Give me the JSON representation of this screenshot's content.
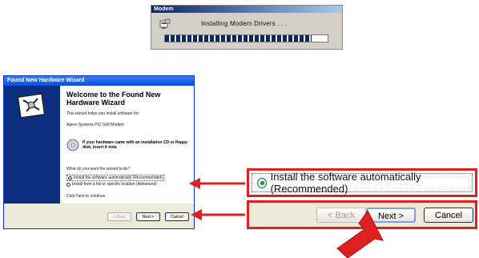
{
  "modem_dialog": {
    "title": "Modem",
    "status": "Installing Modem Drivers . . .",
    "progress": 0.9
  },
  "wizard": {
    "title": "Found New Hardware Wizard",
    "heading": "Welcome to the Found New Hardware Wizard",
    "intro": "This wizard helps you install software for:",
    "device": "Agere Systems PCI Soft Modem",
    "cd_hint": "If your hardware came with an installation CD or floppy disk, insert it now.",
    "question": "What do you want the wizard to do?",
    "option_auto": "Install the software automatically (Recommended)",
    "option_list": "Install from a list or specific location (Advanced)",
    "continue_hint": "Click Next to continue.",
    "back_label": "< Back",
    "next_label": "Next >",
    "cancel_label": "Cancel"
  },
  "callout_option": {
    "label": "Install the software automatically (Recommended)"
  },
  "callout_buttons": {
    "back_label": "< Back",
    "next_label": "Next >",
    "cancel_label": "Cancel"
  },
  "colors": {
    "accent_red": "#e02020",
    "title_blue": "#0a246a",
    "wizard_side": "#0b2f7e"
  }
}
